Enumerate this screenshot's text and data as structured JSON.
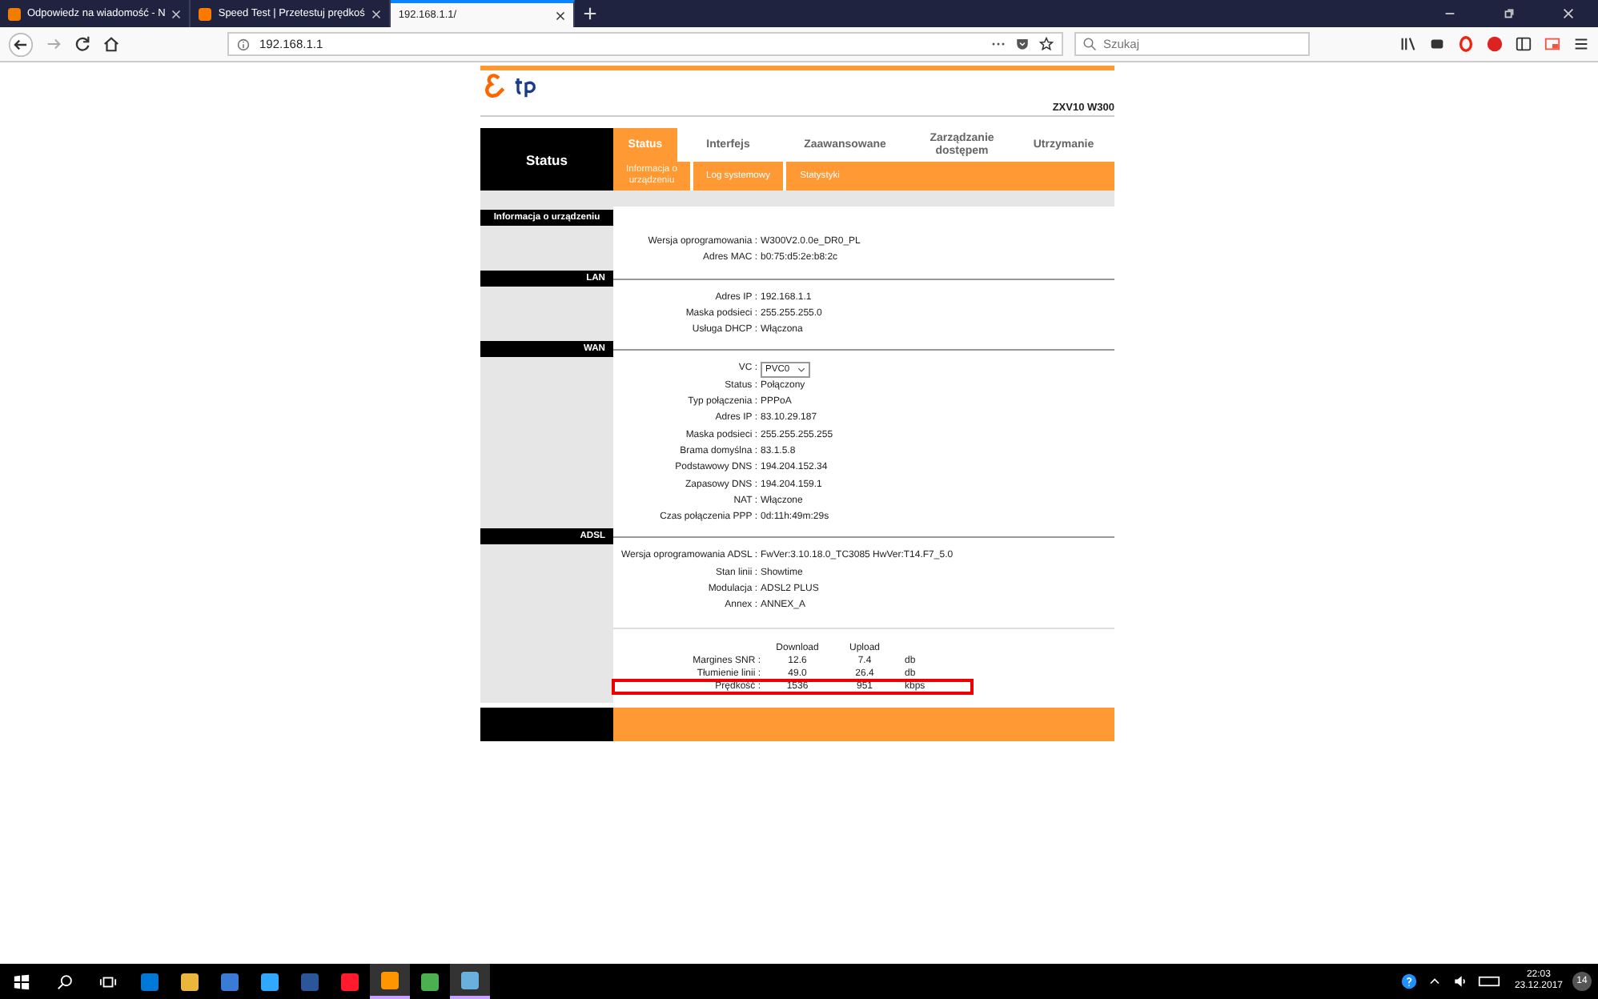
{
  "browser": {
    "tabs": [
      {
        "title": "Odpowiedz na wiadomość - N",
        "selected": false,
        "color": "#f07d00"
      },
      {
        "title": "Speed Test | Przetestuj prędkoś",
        "selected": false,
        "color": "#ff7900"
      },
      {
        "title": "192.168.1.1/",
        "selected": true
      }
    ],
    "url": "192.168.1.1",
    "search": {
      "placeholder": "Szukaj"
    }
  },
  "router": {
    "model": "ZXV10 W300",
    "side_title": "Status",
    "menu": [
      {
        "label": "Status",
        "selected": true
      },
      {
        "label": "Interfejs",
        "selected": false
      },
      {
        "label": "Zaawansowane",
        "selected": false
      },
      {
        "label": "Zarządzanie dostępem",
        "selected": false
      },
      {
        "label": "Utrzymanie",
        "selected": false
      }
    ],
    "submenu": [
      {
        "label": "Informacja o urządzeniu",
        "selected": true
      },
      {
        "label": "Log systemowy",
        "selected": false
      },
      {
        "label": "Statystyki",
        "selected": false
      }
    ],
    "sections": [
      {
        "title": "Informacja o urządzeniu",
        "rows": [
          {
            "kind": "text",
            "label": "Wersja oprogramowania :",
            "value": "W300V2.0.0e_DR0_PL"
          },
          {
            "kind": "text",
            "label": "Adres MAC :",
            "value": "b0:75:d5:2e:b8:2c"
          }
        ]
      },
      {
        "title": "LAN",
        "rows": [
          {
            "kind": "text",
            "label": "Adres IP :",
            "value": "192.168.1.1"
          },
          {
            "kind": "text",
            "label": "Maska podsieci :",
            "value": "255.255.255.0"
          },
          {
            "kind": "text",
            "label": "Usługa DHCP :",
            "value": "Włączona"
          }
        ]
      },
      {
        "title": "WAN",
        "rows": [
          {
            "kind": "select",
            "label": "VC :",
            "value": "PVC0"
          },
          {
            "kind": "text",
            "label": "Status :",
            "value": "Połączony"
          },
          {
            "kind": "text",
            "label": "Typ połączenia :",
            "value": "PPPoA"
          },
          {
            "kind": "text",
            "label": "Adres IP :",
            "value": "83.10.29.187"
          },
          {
            "kind": "text",
            "label": "Maska podsieci :",
            "value": "255.255.255.255"
          },
          {
            "kind": "text",
            "label": "Brama domyślna :",
            "value": "83.1.5.8"
          },
          {
            "kind": "text",
            "label": "Podstawowy DNS :",
            "value": "194.204.152.34"
          },
          {
            "kind": "text",
            "label": "Zapasowy DNS :",
            "value": "194.204.159.1"
          },
          {
            "kind": "text",
            "label": "NAT :",
            "value": "Włączone"
          },
          {
            "kind": "text",
            "label": "Czas połączenia PPP :",
            "value": "0d:11h:49m:29s"
          }
        ]
      },
      {
        "title": "ADSL",
        "rows": [
          {
            "kind": "text",
            "label": "Wersja oprogramowania ADSL :",
            "value": "FwVer:3.10.18.0_TC3085 HwVer:T14.F7_5.0"
          },
          {
            "kind": "text",
            "label": "Stan linii :",
            "value": "Showtime"
          },
          {
            "kind": "text",
            "label": "Modulacja :",
            "value": "ADSL2 PLUS"
          },
          {
            "kind": "text",
            "label": "Annex :",
            "value": "ANNEX_A"
          }
        ],
        "stats": {
          "columns": [
            "Download",
            "Upload"
          ],
          "rows": [
            {
              "label": "Margines SNR :",
              "download": "12.6",
              "upload": "7.4",
              "unit": "db",
              "highlighted": false
            },
            {
              "label": "Tłumienie linii :",
              "download": "49.0",
              "upload": "26.4",
              "unit": "db",
              "highlighted": false
            },
            {
              "label": "Prędkość :",
              "download": "1536",
              "upload": "951",
              "unit": "kbps",
              "highlighted": true
            }
          ]
        }
      }
    ]
  },
  "taskbar": {
    "apps": [
      {
        "color": "#0078d7",
        "open": false
      },
      {
        "color": "#e8b73b",
        "open": false
      },
      {
        "color": "#3a7bd5",
        "open": false
      },
      {
        "color": "#31a8ff",
        "open": false
      },
      {
        "color": "#2b579a",
        "open": false
      },
      {
        "color": "#ff1b2d",
        "open": false
      },
      {
        "color": "#ff9500",
        "open": true
      },
      {
        "color": "#4caf50",
        "open": false
      },
      {
        "color": "#6ab0de",
        "open": true
      }
    ],
    "time": "22:03",
    "date": "23.12.2017",
    "notifications": "14"
  }
}
